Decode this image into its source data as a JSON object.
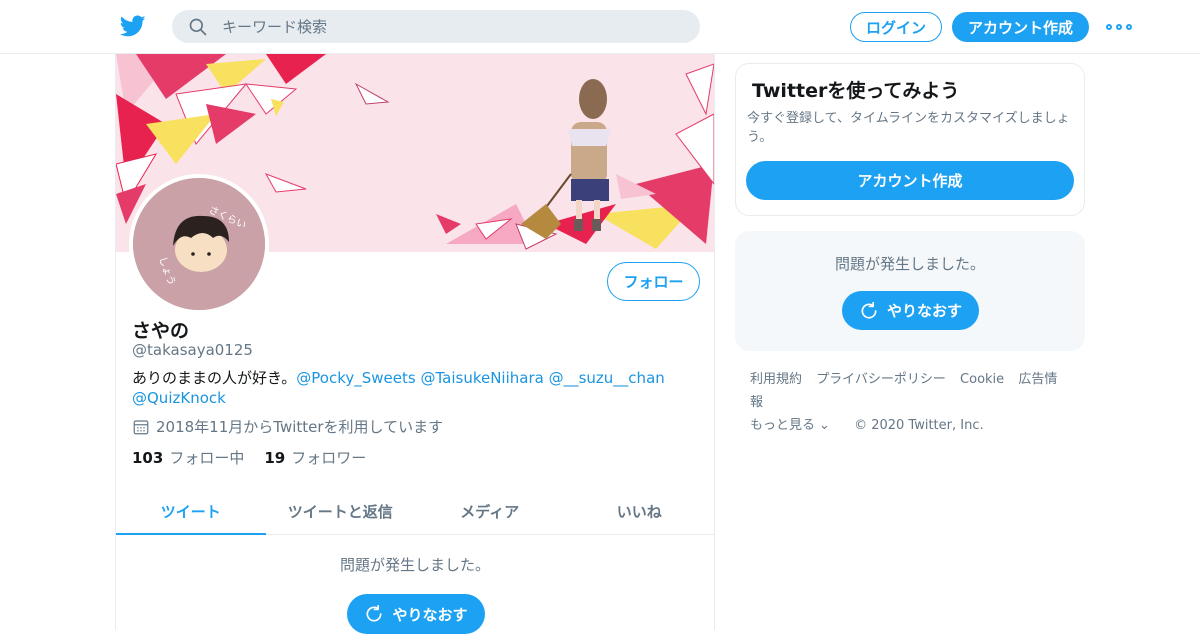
{
  "header": {
    "search_placeholder": "キーワード検索",
    "login_label": "ログイン",
    "signup_label": "アカウント作成"
  },
  "profile": {
    "name": "さやの",
    "handle": "@takasaya0125",
    "bio_text": "ありのままの人が好き。",
    "bio_mentions": [
      "@Pocky_Sweets",
      "@TaisukeNiihara",
      "@__suzu__chan",
      "@QuizKnock"
    ],
    "joined": "2018年11月からTwitterを利用しています",
    "following_count": "103",
    "following_label": "フォロー中",
    "followers_count": "19",
    "followers_label": "フォロワー",
    "follow_button": "フォロー",
    "avatar_text_1": "さくらい",
    "avatar_text_2": "しょう"
  },
  "tabs": [
    "ツイート",
    "ツイートと返信",
    "メディア",
    "いいね"
  ],
  "timeline": {
    "error_message": "問題が発生しました。",
    "retry_label": "やりなおす"
  },
  "sidebar": {
    "signup_card_title": "Twitterを使ってみよう",
    "signup_card_text": "今すぐ登録して、タイムラインをカスタマイズしましょう。",
    "signup_card_button": "アカウント作成",
    "error_message": "問題が発生しました。",
    "retry_label": "やりなおす"
  },
  "footer": {
    "links": [
      "利用規約",
      "プライバシーポリシー",
      "Cookie",
      "広告情報"
    ],
    "more_label": "もっと見る",
    "copyright": "© 2020 Twitter, Inc."
  },
  "colors": {
    "accent": "#1da1f2",
    "muted": "#657786",
    "banner_bg": "#fbe3ea"
  }
}
